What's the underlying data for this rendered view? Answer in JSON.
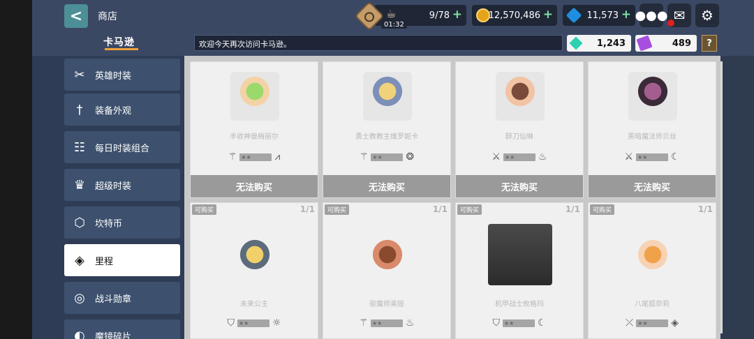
{
  "header": {
    "back_label": "<",
    "title": "商店",
    "brand_tab": "卡马逊",
    "notice": "欢迎今天再次访问卡马逊。"
  },
  "resources": {
    "stamina": "9/78",
    "stamina_timer": "01:32",
    "gold": "12,570,486",
    "gems": "11,573",
    "mileage_crystal": "1,243",
    "ticket": "489",
    "help": "?"
  },
  "sidebar": {
    "items": [
      {
        "label": "英雄时装",
        "icon": "costume-icon"
      },
      {
        "label": "装备外观",
        "icon": "sword-icon"
      },
      {
        "label": "每日时装组合",
        "icon": "costume-set-icon"
      },
      {
        "label": "超级时装",
        "icon": "super-costume-icon"
      },
      {
        "label": "坎特币",
        "icon": "kant-coin-icon"
      },
      {
        "label": "里程",
        "icon": "ticket-icon"
      },
      {
        "label": "战斗勋章",
        "icon": "medal-icon"
      },
      {
        "label": "魔镜碎片",
        "icon": "mirror-icon"
      }
    ]
  },
  "products": [
    {
      "name": "丰收神兽梅丽尔",
      "button": "无法购买",
      "avail": "",
      "count": ""
    },
    {
      "name": "勇士教教主维罗妮卡",
      "button": "无法购买",
      "avail": "",
      "count": ""
    },
    {
      "name": "醉刀仙琳",
      "button": "无法购买",
      "avail": "",
      "count": ""
    },
    {
      "name": "黑暗魔法师贝丝",
      "button": "无法购买",
      "avail": "",
      "count": ""
    },
    {
      "name": "未来公主",
      "button": "",
      "avail": "可购买",
      "count": "1/1"
    },
    {
      "name": "驱魔师美娅",
      "button": "",
      "avail": "可购买",
      "count": "1/1"
    },
    {
      "name": "机甲战士攸格玛",
      "button": "",
      "avail": "可购买",
      "count": "1/1"
    },
    {
      "name": "八尾狐奈莉",
      "button": "",
      "avail": "可购买",
      "count": "1/1"
    }
  ],
  "colors": {
    "accent_orange": "#f2a23a",
    "plus_green": "#7fe3a1",
    "panel_blue": "#3b4863"
  }
}
